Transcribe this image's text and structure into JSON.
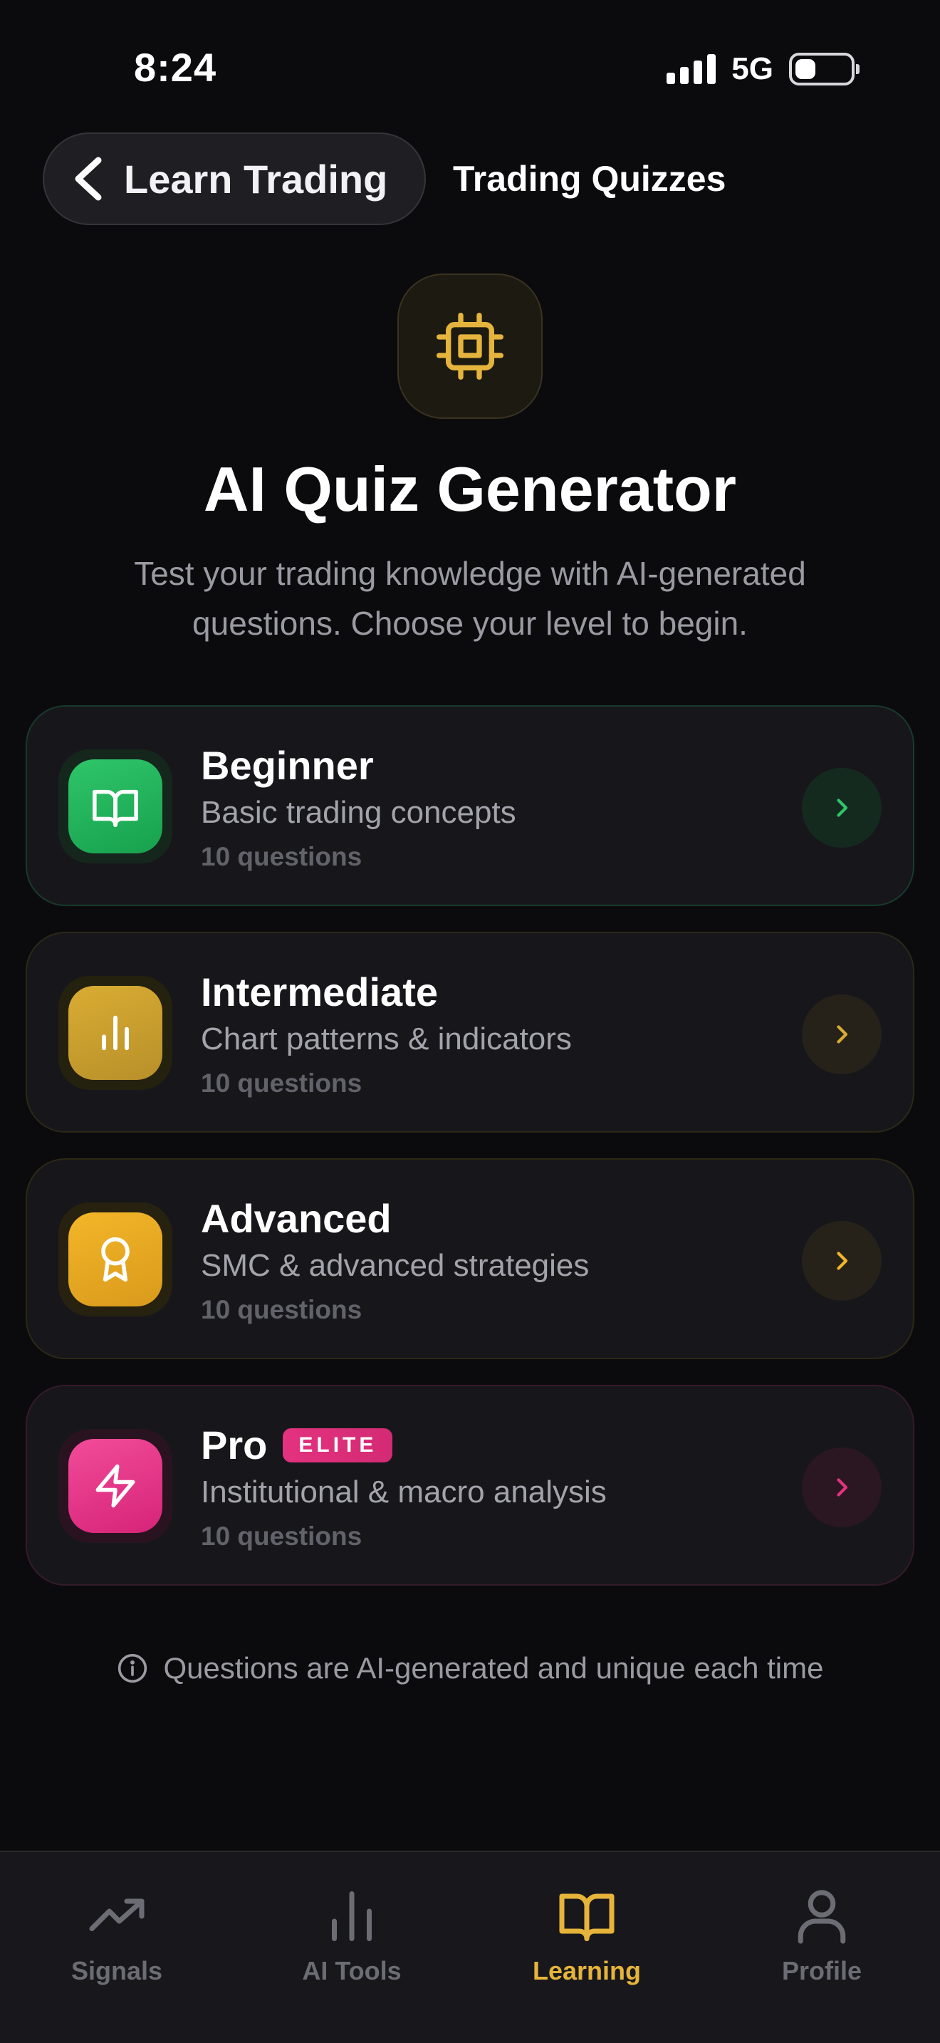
{
  "status_bar": {
    "time": "8:24",
    "network": "5G"
  },
  "header": {
    "back_label": "Learn Trading",
    "title": "Trading Quizzes"
  },
  "hero": {
    "icon": "cpu-chip-icon",
    "title": "AI Quiz Generator",
    "description": "Test your trading knowledge with AI-generated questions. Choose your level to begin."
  },
  "levels": [
    {
      "title": "Beginner",
      "subtitle": "Basic trading concepts",
      "count": "10 questions",
      "icon": "book-open-icon",
      "accent": "#2fc569"
    },
    {
      "title": "Intermediate",
      "subtitle": "Chart patterns & indicators",
      "count": "10 questions",
      "icon": "bar-chart-icon",
      "accent": "#d9ac32"
    },
    {
      "title": "Advanced",
      "subtitle": "SMC & advanced strategies",
      "count": "10 questions",
      "icon": "award-icon",
      "accent": "#f3b628"
    },
    {
      "title": "Pro",
      "badge": "ELITE",
      "subtitle": "Institutional & macro analysis",
      "count": "10 questions",
      "icon": "zap-icon",
      "accent": "#e3327f"
    }
  ],
  "footer_note": {
    "icon": "info-icon",
    "text": "Questions are AI-generated and unique each time"
  },
  "tabs": [
    {
      "label": "Signals",
      "icon": "trending-up-icon"
    },
    {
      "label": "AI Tools",
      "icon": "bar-chart-icon"
    },
    {
      "label": "Learning",
      "icon": "book-open-icon",
      "active": true
    },
    {
      "label": "Profile",
      "icon": "user-icon"
    }
  ],
  "colors": {
    "background": "#0b0b0e",
    "active_tab": "#e6b43a",
    "muted": "#9a9aa2"
  }
}
